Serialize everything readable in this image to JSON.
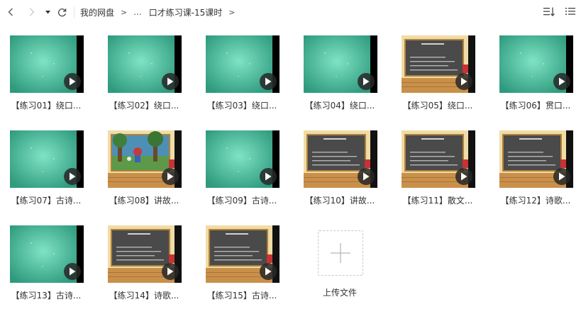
{
  "toolbar": {
    "back_icon": "chevron-left-icon",
    "forward_icon": "chevron-right-icon",
    "breadcrumb": {
      "root": "我的网盘",
      "separator": ">",
      "ellipsis": "...",
      "current": "口才练习课-15课时",
      "trailing_separator": ">"
    },
    "sort_icon": "sort-icon",
    "view_icon": "list-view-icon"
  },
  "files": [
    {
      "label": "【练习01】绕口...",
      "thumb": "teal"
    },
    {
      "label": "【练习02】绕口...",
      "thumb": "teal"
    },
    {
      "label": "【练习03】绕口...",
      "thumb": "teal"
    },
    {
      "label": "【练习04】绕口...",
      "thumb": "teal"
    },
    {
      "label": "【练习05】绕口...",
      "thumb": "board"
    },
    {
      "label": "【练习06】贯口...",
      "thumb": "teal"
    },
    {
      "label": "【练习07】古诗...",
      "thumb": "teal"
    },
    {
      "label": "【练习08】讲故...",
      "thumb": "forest"
    },
    {
      "label": "【练习09】古诗...",
      "thumb": "teal"
    },
    {
      "label": "【练习10】讲故...",
      "thumb": "board"
    },
    {
      "label": "【练习11】散文...",
      "thumb": "board"
    },
    {
      "label": "【练习12】诗歌...",
      "thumb": "board"
    },
    {
      "label": "【练习13】古诗...",
      "thumb": "teal"
    },
    {
      "label": "【练习14】诗歌...",
      "thumb": "board"
    },
    {
      "label": "【练习15】古诗...",
      "thumb": "board"
    }
  ],
  "upload": {
    "label": "上传文件",
    "icon": "plus-icon"
  },
  "colors": {
    "teal_center": "#7fe3c3",
    "teal_edge": "#2f9a7e",
    "board": "#4a4a4a",
    "board_frame": "#b0813a",
    "floor": "#c9904a",
    "wall": "#f0dca6"
  }
}
